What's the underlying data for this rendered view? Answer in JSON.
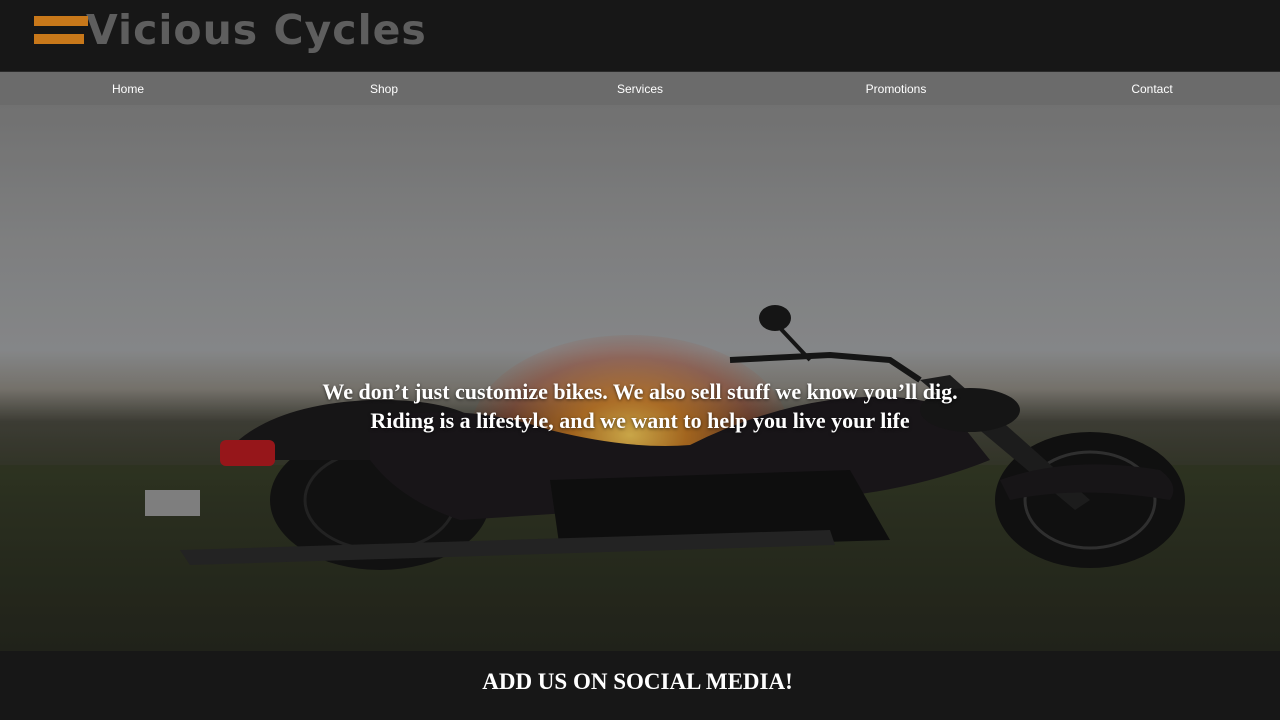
{
  "header": {
    "logo_text": "Vicious Cycles",
    "logo_accent_color": "#c8781a",
    "logo_text_color": "#5e5e5e"
  },
  "nav": {
    "items": [
      {
        "label": "Home"
      },
      {
        "label": "Shop"
      },
      {
        "label": "Services"
      },
      {
        "label": "Promotions"
      },
      {
        "label": "Contact"
      }
    ]
  },
  "hero": {
    "image": "motorcycle-sunset",
    "tagline_line1": "We don’t just customize bikes. We also sell stuff we know you’ll dig.",
    "tagline_line2": "Riding is a lifestyle, and we want to help you live your life"
  },
  "footer": {
    "social_heading": "ADD US ON SOCIAL MEDIA!"
  }
}
